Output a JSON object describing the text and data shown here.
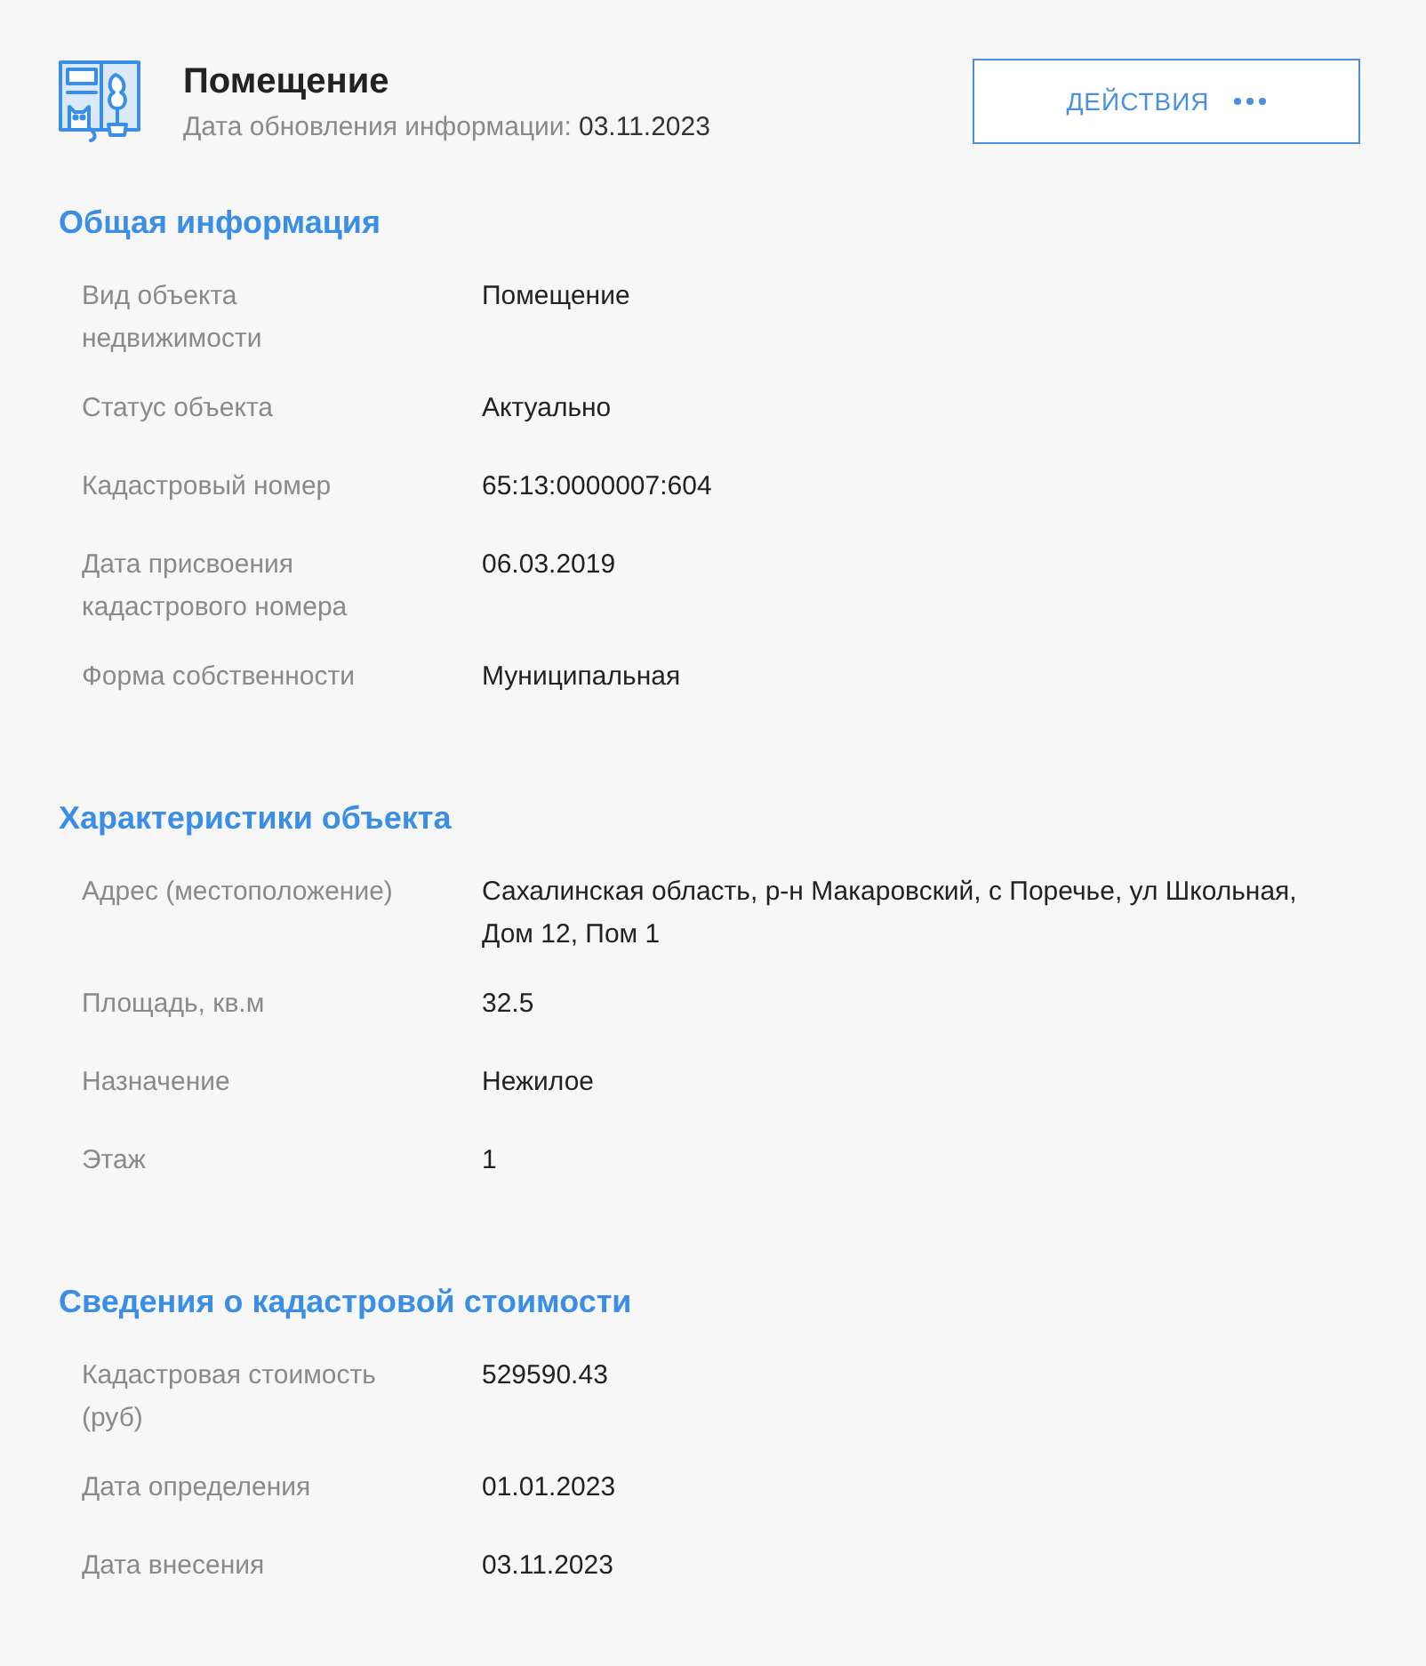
{
  "header": {
    "title": "Помещение",
    "update_label": "Дата обновления информации:",
    "update_date": "03.11.2023",
    "actions_button": "ДЕЙСТВИЯ"
  },
  "sections": [
    {
      "title": "Общая информация",
      "rows": [
        {
          "label": "Вид объекта недвижимости",
          "value": "Помещение"
        },
        {
          "label": "Статус объекта",
          "value": "Актуально"
        },
        {
          "label": "Кадастровый номер",
          "value": "65:13:0000007:604"
        },
        {
          "label": "Дата присвоения кадастрового номера",
          "value": "06.03.2019"
        },
        {
          "label": "Форма собственности",
          "value": "Муниципальная"
        }
      ]
    },
    {
      "title": "Характеристики объекта",
      "rows": [
        {
          "label": "Адрес (местоположение)",
          "value": "Сахалинская область, р-н Макаровский, с Поречье, ул Школьная, Дом 12, Пом 1"
        },
        {
          "label": "Площадь, кв.м",
          "value": "32.5"
        },
        {
          "label": "Назначение",
          "value": "Нежилое"
        },
        {
          "label": "Этаж",
          "value": "1"
        }
      ]
    },
    {
      "title": "Сведения о кадастровой стоимости",
      "rows": [
        {
          "label": "Кадастровая стоимость (руб)",
          "value": "529590.43"
        },
        {
          "label": "Дата определения",
          "value": "01.01.2023"
        },
        {
          "label": "Дата внесения",
          "value": "03.11.2023"
        }
      ]
    }
  ]
}
